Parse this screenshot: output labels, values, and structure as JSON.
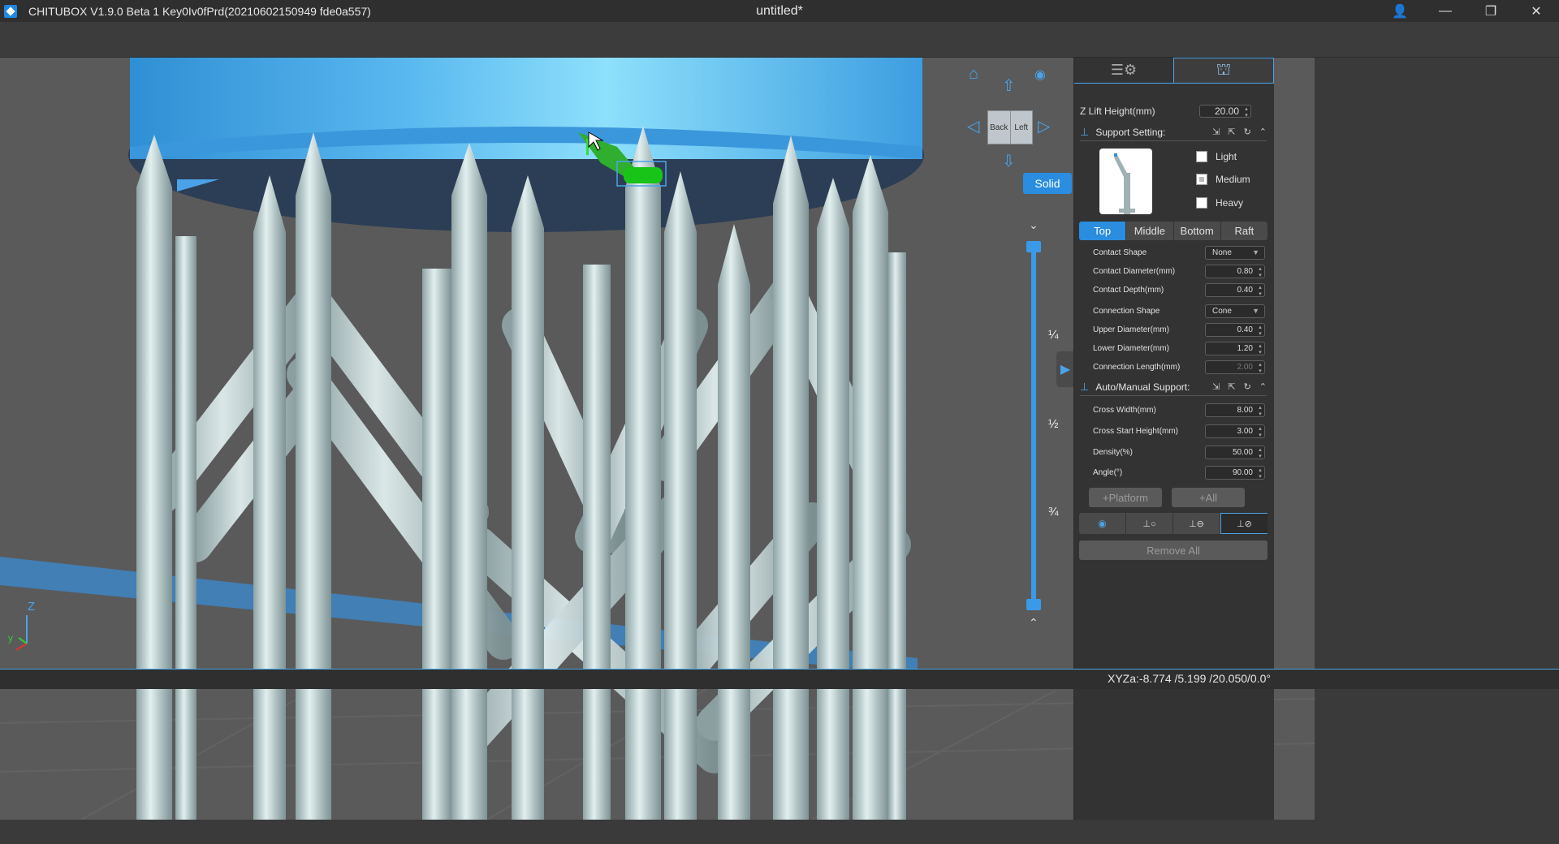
{
  "titlebar": {
    "app_title": "CHITUBOX V1.9.0 Beta 1 Key0Iv0fPrd(20210602150949 fde0a557)",
    "document_title": "untitled*",
    "user_glyph": "👤",
    "minimize_glyph": "—",
    "restore_glyph": "❐",
    "close_glyph": "✕"
  },
  "viewport": {
    "nav_cube": {
      "back": "Back",
      "left": "Left"
    },
    "home_glyph": "⌂",
    "up_glyph": "⇧",
    "down_glyph": "⇩",
    "left_glyph": "◁",
    "right_glyph": "▷",
    "eye_glyph": "◉",
    "solid_button": "Solid",
    "layer_marks": [
      "¼",
      "½",
      "¾"
    ],
    "slider_collapse_top": "⌄",
    "slider_collapse_bottom": "⌃",
    "panel_collapse_glyph": "▶",
    "axis": {
      "z": "Z",
      "y": "y"
    }
  },
  "panel": {
    "tabs": [
      {
        "name": "settings",
        "glyph": "☰⚙"
      },
      {
        "name": "support",
        "glyph": "⛫"
      }
    ],
    "z_lift": {
      "label": "Z Lift Height(mm)",
      "value": "20.00"
    },
    "support_setting": {
      "label": "Support Setting:"
    },
    "densities": [
      {
        "label": "Light"
      },
      {
        "label": "Medium"
      },
      {
        "label": "Heavy"
      }
    ],
    "segments": [
      "Top",
      "Middle",
      "Bottom",
      "Raft"
    ],
    "contact": [
      {
        "label": "Contact Shape",
        "value": "None",
        "kind": "select"
      },
      {
        "label": "Contact Diameter(mm)",
        "value": "0.80",
        "kind": "spin"
      },
      {
        "label": "Contact Depth(mm)",
        "value": "0.40",
        "kind": "spin"
      }
    ],
    "connection": [
      {
        "label": "Connection Shape",
        "value": "Cone",
        "kind": "select"
      },
      {
        "label": "Upper Diameter(mm)",
        "value": "0.40",
        "kind": "spin"
      },
      {
        "label": "Lower Diameter(mm)",
        "value": "1.20",
        "kind": "spin"
      },
      {
        "label": "Connection Length(mm)",
        "value": "2.00",
        "kind": "spin"
      }
    ],
    "auto_manual": {
      "label": "Auto/Manual Support:"
    },
    "cross": [
      {
        "label": "Cross Width(mm)",
        "value": "8.00"
      },
      {
        "label": "Cross Start Height(mm)",
        "value": "3.00"
      },
      {
        "label": "Density(%)",
        "value": "50.00"
      },
      {
        "label": "Angle(°)",
        "value": "90.00"
      }
    ],
    "add_platform": "+Platform",
    "add_all": "+All",
    "mode_glyphs": [
      "◉",
      "⊥○",
      "⊥⊖",
      "⊥⊘"
    ],
    "remove_all": "Remove All"
  },
  "status": {
    "coords": "XYZa:-8.774 /5.199 /20.050/0.0°"
  },
  "colors": {
    "accent": "#2a8ddf",
    "model_blue": "#4aa3e8",
    "support_gray": "#b7c8c8"
  }
}
